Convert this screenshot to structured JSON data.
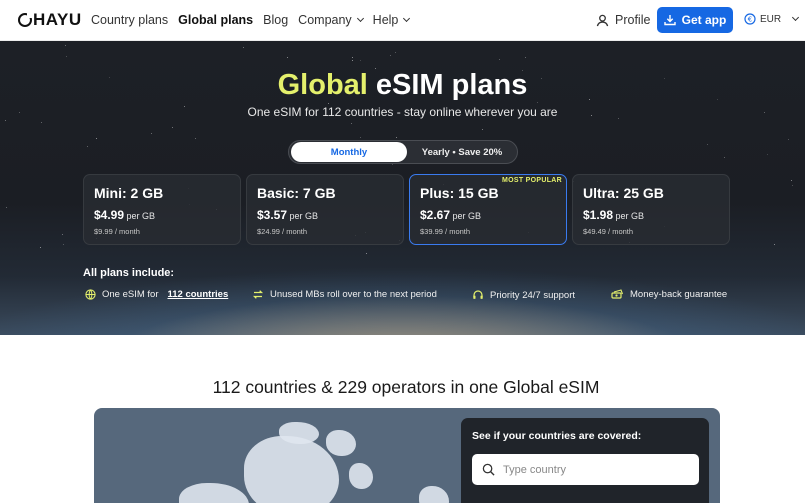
{
  "header": {
    "brand": "HAYU",
    "nav": [
      {
        "label": "Country plans"
      },
      {
        "label": "Global plans"
      },
      {
        "label": "Blog"
      },
      {
        "label": "Company"
      },
      {
        "label": "Help"
      }
    ],
    "profile_label": "Profile",
    "get_app_label": "Get app",
    "currency": "EUR"
  },
  "hero": {
    "title_highlight": "Global",
    "title_rest": " eSIM plans",
    "subtitle": "One eSIM for 112 countries - stay online wherever you are",
    "billing_toggle": {
      "monthly": "Monthly",
      "yearly": "Yearly • Save 20%",
      "selected": "Monthly"
    },
    "plans": [
      {
        "name": "Mini: 2 GB",
        "price": "$4.99",
        "unit": "per GB",
        "monthly": "$9.99 / month"
      },
      {
        "name": "Basic: 7 GB",
        "price": "$3.57",
        "unit": "per GB",
        "monthly": "$24.99 / month"
      },
      {
        "name": "Plus: 15 GB",
        "price": "$2.67",
        "unit": "per GB",
        "monthly": "$39.99 / month",
        "badge": "MOST POPULAR"
      },
      {
        "name": "Ultra: 25 GB",
        "price": "$1.98",
        "unit": "per GB",
        "monthly": "$49.49 / month"
      }
    ],
    "includes_title": "All plans include:",
    "features": [
      {
        "text": "One eSIM for",
        "link": "112 countries",
        "icon": "globe-icon"
      },
      {
        "text": "Unused MBs roll over to the next period",
        "icon": "rollover-icon"
      },
      {
        "text": "Priority 24/7 support",
        "icon": "headset-icon"
      },
      {
        "text": "Money-back guarantee",
        "icon": "money-icon"
      }
    ]
  },
  "coverage": {
    "title": "112 countries & 229 operators in one Global eSIM",
    "panel_label": "See if your countries are covered:",
    "search_placeholder": "Type country"
  },
  "colors": {
    "accent": "#1668e3",
    "highlight": "#e4f06c"
  }
}
